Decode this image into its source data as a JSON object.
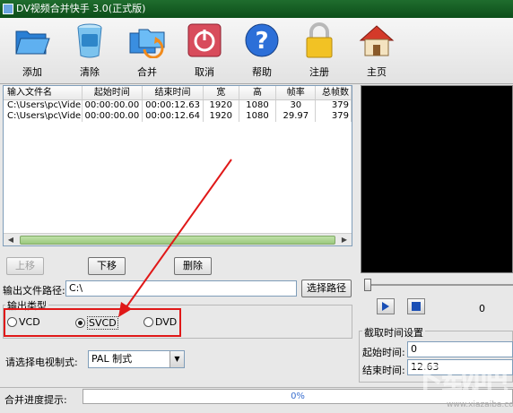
{
  "window": {
    "title": "DV视频合并快手 3.0(正式版)"
  },
  "toolbar": {
    "add": "添加",
    "clear": "清除",
    "merge": "合并",
    "cancel": "取消",
    "help": "帮助",
    "register": "注册",
    "home": "主页"
  },
  "file_list": {
    "columns": [
      "输入文件名",
      "起始时间",
      "结束时间",
      "宽",
      "高",
      "帧率",
      "总帧数"
    ],
    "rows": [
      [
        "C:\\Users\\pc\\Vide...",
        "00:00:00.00",
        "00:00:12.63",
        "1920",
        "1080",
        "30",
        "379"
      ],
      [
        "C:\\Users\\pc\\Vide...",
        "00:00:00.00",
        "00:00:12.64",
        "1920",
        "1080",
        "29.97",
        "379"
      ]
    ]
  },
  "list_buttons": {
    "up": "上移",
    "down": "下移",
    "delete": "删除"
  },
  "output": {
    "path_label": "输出文件路径:",
    "path_value": "C:\\",
    "browse": "选择路径"
  },
  "output_type": {
    "label": "输出类型",
    "options": [
      "VCD",
      "SVCD",
      "DVD"
    ],
    "selected": "SVCD"
  },
  "tv_system": {
    "label": "请选择电视制式:",
    "value": "PAL 制式"
  },
  "progress": {
    "label": "合并进度提示:",
    "value": "0%",
    "fraction": 0
  },
  "preview": {
    "counter": "0"
  },
  "clip_time": {
    "group": "截取时间设置",
    "start_label": "起始时间:",
    "start_value": "0",
    "end_label": "结束时间:",
    "end_value": "12.63"
  },
  "watermark": {
    "text": "下载吧",
    "url": "www.xiazaiba.com"
  },
  "colors": {
    "title_bar": "#1f6d2e",
    "highlight_box": "#e01818",
    "arrow": "#e01818",
    "progress_text": "#3a6fcf"
  }
}
